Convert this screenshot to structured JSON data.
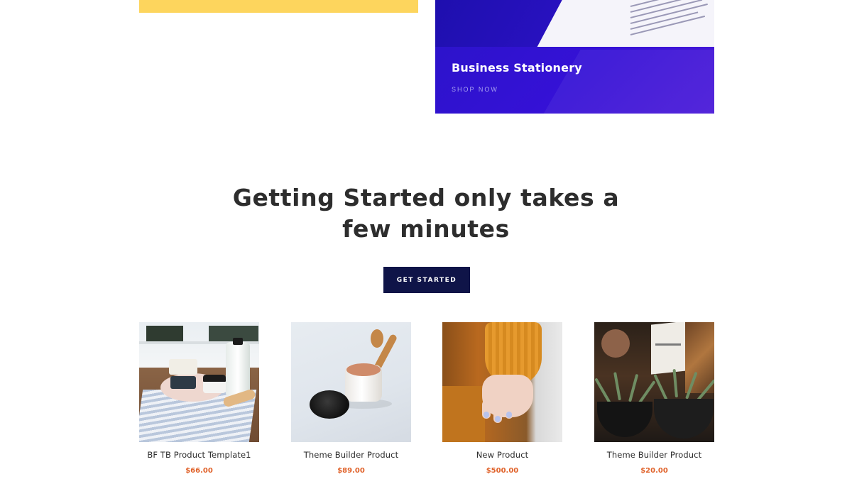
{
  "banners": {
    "stationery": {
      "title": "Business Stationery",
      "link": "SHOP NOW"
    }
  },
  "cta": {
    "headline_line1": "Getting Started only takes a",
    "headline_line2": "few minutes",
    "button_label": "GET STARTED"
  },
  "products": [
    {
      "name": "BF TB Product Template1",
      "price": "$66.00",
      "image_icon": "soap-bath-products-image"
    },
    {
      "name": "Theme Builder Product",
      "price": "$89.00",
      "image_icon": "powder-jar-image"
    },
    {
      "name": "New Product",
      "price": "$500.00",
      "image_icon": "hand-sweater-image"
    },
    {
      "name": "Theme Builder Product",
      "price": "$20.00",
      "image_icon": "potted-plants-image"
    }
  ],
  "colors": {
    "yellow_banner": "#fdd55d",
    "purple_banner": "#3511d6",
    "button_bg": "#0f1448",
    "price": "#e0622a",
    "heading": "#2d2d2d"
  }
}
